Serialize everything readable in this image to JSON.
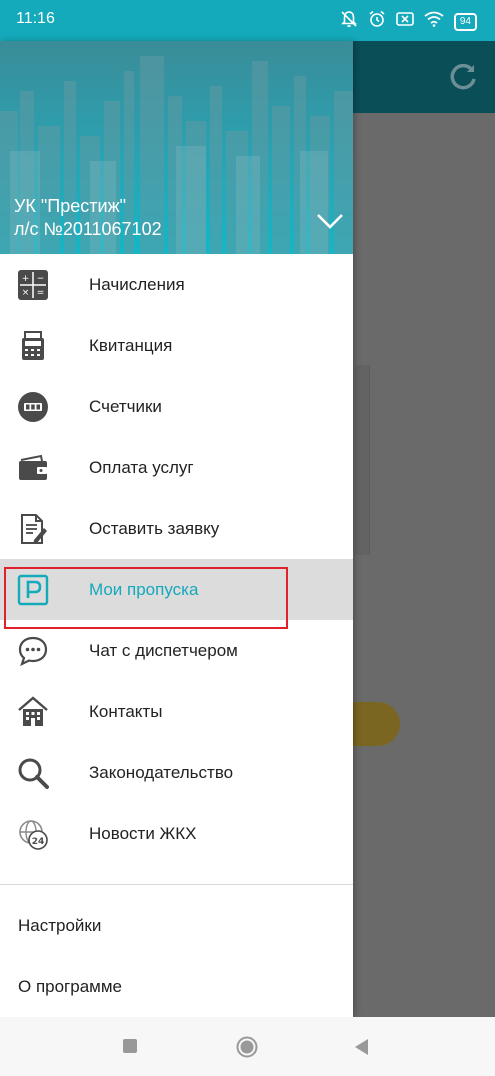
{
  "status_bar": {
    "time": "11:16",
    "battery": "94",
    "icons": [
      "bell-off-icon",
      "alarm-icon",
      "sim-off-icon",
      "wifi-icon",
      "battery-icon"
    ]
  },
  "drawer": {
    "account_name": "УК \"Престиж\"",
    "account_number": "л/с №2011067102",
    "menu": [
      {
        "label": "Начисления",
        "icon": "calculator-icon"
      },
      {
        "label": "Квитанция",
        "icon": "receipt-icon"
      },
      {
        "label": "Счетчики",
        "icon": "meter-icon"
      },
      {
        "label": "Оплата услуг",
        "icon": "wallet-icon"
      },
      {
        "label": "Оставить заявку",
        "icon": "document-edit-icon"
      },
      {
        "label": "Мои пропуска",
        "icon": "parking-pass-icon",
        "active": true
      },
      {
        "label": "Чат с диспетчером",
        "icon": "chat-icon"
      },
      {
        "label": "Контакты",
        "icon": "building-icon"
      },
      {
        "label": "Законодательство",
        "icon": "magnifier-icon"
      },
      {
        "label": "Новости ЖКХ",
        "icon": "news-24-icon"
      }
    ],
    "settings_label": "Настройки",
    "about_label": "О программе"
  },
  "colors": {
    "accent": "#14a9bb",
    "highlight_border": "#e0222a"
  }
}
